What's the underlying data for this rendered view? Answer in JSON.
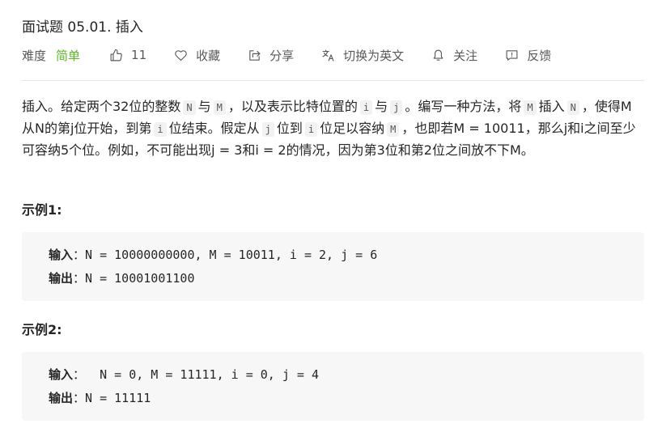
{
  "problem": {
    "title": "面试题 05.01. 插入"
  },
  "meta": {
    "difficulty_label": "难度",
    "difficulty_value": "简单",
    "likes": "11",
    "collect": "收藏",
    "share": "分享",
    "switch_lang": "切换为英文",
    "follow": "关注",
    "feedback": "反馈"
  },
  "description": {
    "p1": "插入。给定两个32位的整数",
    "c_N": "N",
    "p2": "与",
    "c_M": "M",
    "p3": "，以及表示比特位置的",
    "c_i": "i",
    "p4": "与",
    "c_j": "j",
    "p5": "。编写一种方法，将",
    "c_M2": "M",
    "p6": "插入",
    "c_N2": "N",
    "p7": "，使得M从N的第j位开始，到第",
    "c_i2": "i",
    "p8": "位结束。假定从",
    "c_j2": "j",
    "p9": "位到",
    "c_i3": "i",
    "p10": "位足以容纳",
    "c_M3": "M",
    "p11": "，也即若M = 10011，那么j和i之间至少可容纳5个位。例如，不可能出现j = 3和i = 2的情况，因为第3位和第2位之间放不下M。"
  },
  "examples": [
    {
      "title": "示例1:",
      "input_label": "输入",
      "input": "：N = 10000000000, M = 10011, i = 2, j = 6",
      "output_label": "输出",
      "output": "：N = 10001001100"
    },
    {
      "title": "示例2:",
      "input_label": "输入",
      "input": "：  N = 0, M = 11111, i = 0, j = 4",
      "output_label": "输出",
      "output": "：N = 11111"
    }
  ]
}
